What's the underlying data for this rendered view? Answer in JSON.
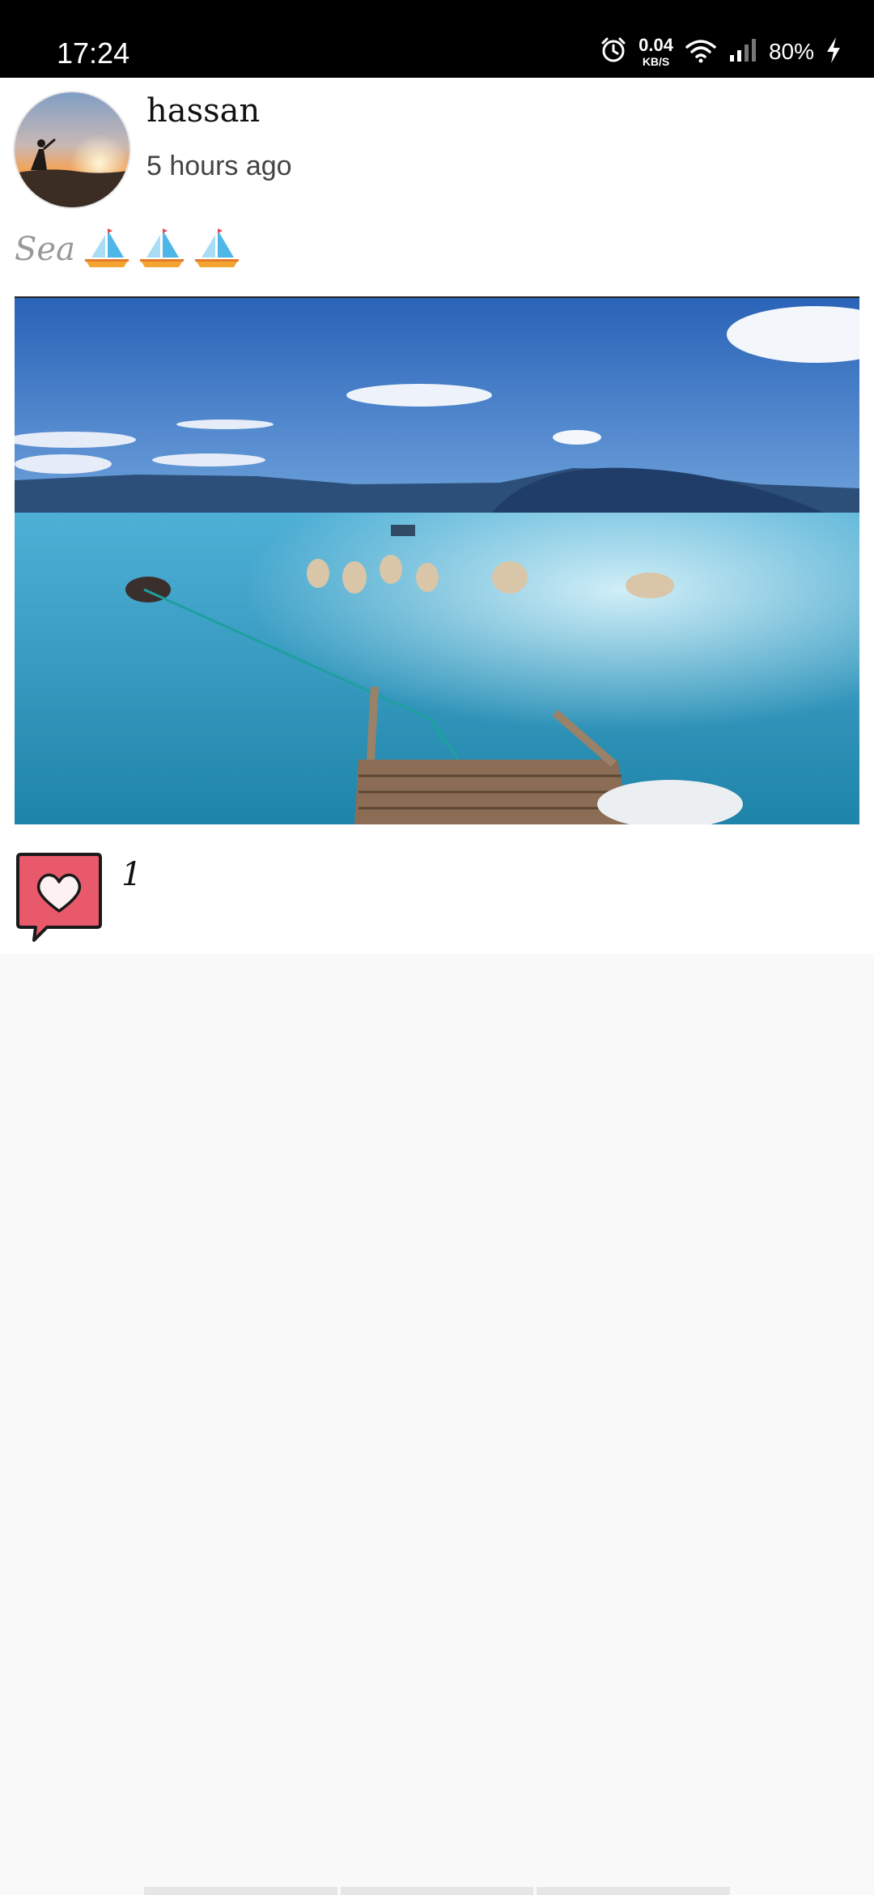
{
  "status_bar": {
    "time": "17:24",
    "net_speed_value": "0.04",
    "net_speed_unit": "KB/S",
    "battery": "80%"
  },
  "post": {
    "username": "hassan",
    "time_ago": "5 hours ago",
    "caption": "Sea",
    "caption_emoji": [
      "sailboat",
      "sailboat",
      "sailboat"
    ],
    "likes": "1"
  },
  "colors": {
    "like_red": "#e85a6b",
    "sky": "#3c74c8",
    "water": "#2f93b4",
    "status_bg": "#000000"
  },
  "icons": [
    "alarm-icon",
    "wifi-icon",
    "signal-icon",
    "charging-icon",
    "heart-like-icon"
  ]
}
